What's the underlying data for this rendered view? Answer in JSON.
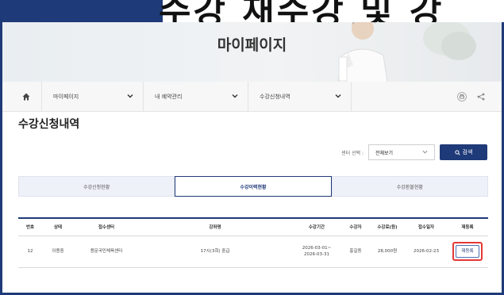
{
  "banner": {
    "caption": "수강  재수강 및 강"
  },
  "hero": {
    "title": "마이페이지"
  },
  "nav": {
    "menus": [
      {
        "label": "마이페이지"
      },
      {
        "label": "내 예약관리"
      },
      {
        "label": "수강신청내역"
      }
    ]
  },
  "page": {
    "title": "수강신청내역"
  },
  "filter": {
    "label": "센터 선택 :",
    "selected": "전체보기",
    "search_label": "검색"
  },
  "tabs": [
    {
      "label": "수강신청현황",
      "active": false
    },
    {
      "label": "수강이력현황",
      "active": true
    },
    {
      "label": "수강환불현황",
      "active": false
    }
  ],
  "table": {
    "headers": [
      "번호",
      "상태",
      "접수센터",
      "강좌명",
      "수강기간",
      "수강자",
      "수강료(원)",
      "접수일자",
      "재등록"
    ],
    "rows": [
      {
        "no": "12",
        "status": "이용중",
        "center": "용문국민체육센터",
        "course": "17시(3회) 중급",
        "period_start": "2026-03-01~",
        "period_end": "2026-03-31",
        "student": "홍길동",
        "fee": "28,000원",
        "date": "2026-02-23",
        "action": "재등록"
      }
    ]
  },
  "colors": {
    "navy": "#1f3a78",
    "highlight": "#e53935"
  }
}
